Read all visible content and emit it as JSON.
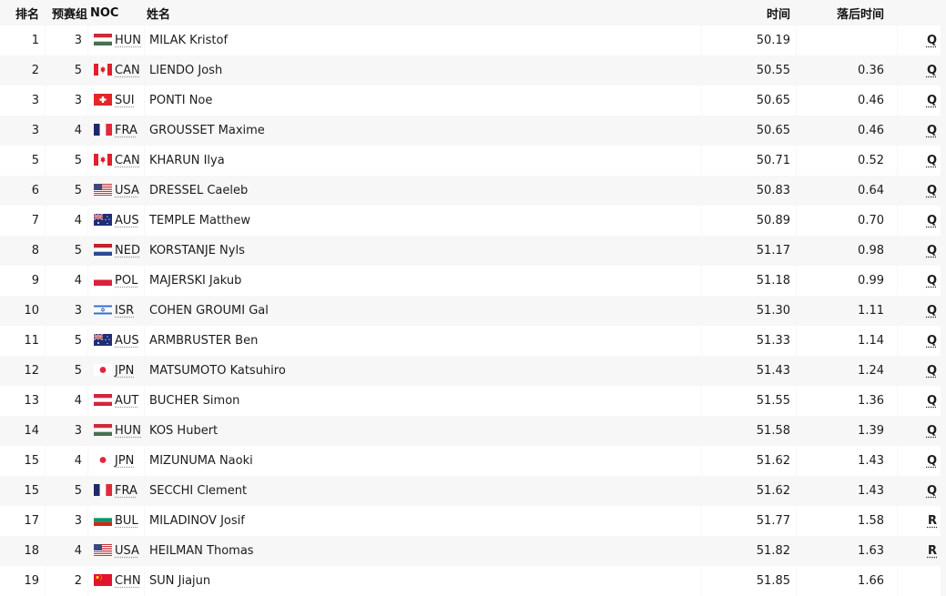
{
  "headers": {
    "rank": "排名",
    "heat": "预赛组",
    "noc": "NOC",
    "name": "姓名",
    "time": "时间",
    "behind": "落后时间",
    "qual": ""
  },
  "rows": [
    {
      "rank": "1",
      "heat": "3",
      "noc": "HUN",
      "name": "MILAK Kristof",
      "time": "50.19",
      "behind": "",
      "qual": "Q"
    },
    {
      "rank": "2",
      "heat": "5",
      "noc": "CAN",
      "name": "LIENDO Josh",
      "time": "50.55",
      "behind": "0.36",
      "qual": "Q"
    },
    {
      "rank": "3",
      "heat": "3",
      "noc": "SUI",
      "name": "PONTI Noe",
      "time": "50.65",
      "behind": "0.46",
      "qual": "Q"
    },
    {
      "rank": "3",
      "heat": "4",
      "noc": "FRA",
      "name": "GROUSSET Maxime",
      "time": "50.65",
      "behind": "0.46",
      "qual": "Q"
    },
    {
      "rank": "5",
      "heat": "5",
      "noc": "CAN",
      "name": "KHARUN Ilya",
      "time": "50.71",
      "behind": "0.52",
      "qual": "Q"
    },
    {
      "rank": "6",
      "heat": "5",
      "noc": "USA",
      "name": "DRESSEL Caeleb",
      "time": "50.83",
      "behind": "0.64",
      "qual": "Q"
    },
    {
      "rank": "7",
      "heat": "4",
      "noc": "AUS",
      "name": "TEMPLE Matthew",
      "time": "50.89",
      "behind": "0.70",
      "qual": "Q"
    },
    {
      "rank": "8",
      "heat": "5",
      "noc": "NED",
      "name": "KORSTANJE Nyls",
      "time": "51.17",
      "behind": "0.98",
      "qual": "Q"
    },
    {
      "rank": "9",
      "heat": "4",
      "noc": "POL",
      "name": "MAJERSKI Jakub",
      "time": "51.18",
      "behind": "0.99",
      "qual": "Q"
    },
    {
      "rank": "10",
      "heat": "3",
      "noc": "ISR",
      "name": "COHEN GROUMI Gal",
      "time": "51.30",
      "behind": "1.11",
      "qual": "Q"
    },
    {
      "rank": "11",
      "heat": "5",
      "noc": "AUS",
      "name": "ARMBRUSTER Ben",
      "time": "51.33",
      "behind": "1.14",
      "qual": "Q"
    },
    {
      "rank": "12",
      "heat": "5",
      "noc": "JPN",
      "name": "MATSUMOTO Katsuhiro",
      "time": "51.43",
      "behind": "1.24",
      "qual": "Q"
    },
    {
      "rank": "13",
      "heat": "4",
      "noc": "AUT",
      "name": "BUCHER Simon",
      "time": "51.55",
      "behind": "1.36",
      "qual": "Q"
    },
    {
      "rank": "14",
      "heat": "3",
      "noc": "HUN",
      "name": "KOS Hubert",
      "time": "51.58",
      "behind": "1.39",
      "qual": "Q"
    },
    {
      "rank": "15",
      "heat": "4",
      "noc": "JPN",
      "name": "MIZUNUMA Naoki",
      "time": "51.62",
      "behind": "1.43",
      "qual": "Q"
    },
    {
      "rank": "15",
      "heat": "5",
      "noc": "FRA",
      "name": "SECCHI Clement",
      "time": "51.62",
      "behind": "1.43",
      "qual": "Q"
    },
    {
      "rank": "17",
      "heat": "3",
      "noc": "BUL",
      "name": "MILADINOV Josif",
      "time": "51.77",
      "behind": "1.58",
      "qual": "R"
    },
    {
      "rank": "18",
      "heat": "4",
      "noc": "USA",
      "name": "HEILMAN Thomas",
      "time": "51.82",
      "behind": "1.63",
      "qual": "R"
    },
    {
      "rank": "19",
      "heat": "2",
      "noc": "CHN",
      "name": "SUN Jiajun",
      "time": "51.85",
      "behind": "1.66",
      "qual": ""
    }
  ],
  "flags": {
    "HUN": "flag-hungary-icon",
    "CAN": "flag-canada-icon",
    "SUI": "flag-switzerland-icon",
    "FRA": "flag-france-icon",
    "USA": "flag-usa-icon",
    "AUS": "flag-australia-icon",
    "NED": "flag-netherlands-icon",
    "POL": "flag-poland-icon",
    "ISR": "flag-israel-icon",
    "JPN": "flag-japan-icon",
    "AUT": "flag-austria-icon",
    "BUL": "flag-bulgaria-icon",
    "CHN": "flag-china-icon"
  },
  "colors": {
    "row_alt": "#f7f7f7",
    "row": "#ffffff",
    "text": "#1c1c1c"
  }
}
